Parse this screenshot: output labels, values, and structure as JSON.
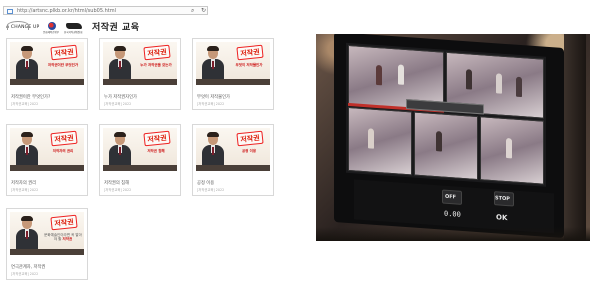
{
  "browser": {
    "url": "http://artsnc.plkb.or.kr/html/sub05.html",
    "search_icon": "search-icon",
    "refresh_icon": "refresh-icon"
  },
  "header": {
    "logos": [
      {
        "name": "a-change-up-logo",
        "text": "A CHANGE UP"
      },
      {
        "name": "government-seal-logo",
        "text": "문화체육관광부"
      },
      {
        "name": "copyright-commission-logo",
        "text": "한국저작권위원회"
      }
    ],
    "title": "저작권 교육"
  },
  "cards": [
    {
      "stamp": "저작권",
      "subtitle_plain": "",
      "subtitle_red": "저작권이란 무엇인가",
      "title": "저작권이란 무엇인가?",
      "meta": "[저작권교육] 2022"
    },
    {
      "stamp": "저작권",
      "subtitle_plain": "",
      "subtitle_red": "누가 저작권을 갖는가",
      "title": "누가 저작권자인가",
      "meta": "[저작권교육] 2022"
    },
    {
      "stamp": "저작권",
      "subtitle_plain": "",
      "subtitle_red": "무엇이 저작물인가",
      "title": "무엇이 저작물인가",
      "meta": "[저작권교육] 2022"
    },
    {
      "stamp": "저작권",
      "subtitle_plain": "",
      "subtitle_red": "저작자의 권리",
      "title": "저작자의 권리",
      "meta": "[저작권교육] 2022"
    },
    {
      "stamp": "저작권",
      "subtitle_plain": "",
      "subtitle_red": "저작권 침해",
      "title": "저작권의 침해",
      "meta": "[저작권교육] 2022"
    },
    {
      "stamp": "저작권",
      "subtitle_plain": "",
      "subtitle_red": "공정 이용",
      "title": "공정 이용",
      "meta": "[저작권교육] 2022"
    },
    {
      "stamp": "저작권",
      "subtitle_plain": "문화예술인이라면 꼭 알아야 할",
      "subtitle_red": "저작권",
      "title": "연극관계자, 저작권",
      "meta": "[저작권교육] 2022"
    }
  ],
  "photo": {
    "alt_icon": "broadcast-monitor-photo",
    "panel_labels": {
      "off": "OFF",
      "stop": "STOP",
      "ok": "OK"
    },
    "panel_numbers": {
      "left": "0.00",
      "right": "0.00"
    }
  }
}
